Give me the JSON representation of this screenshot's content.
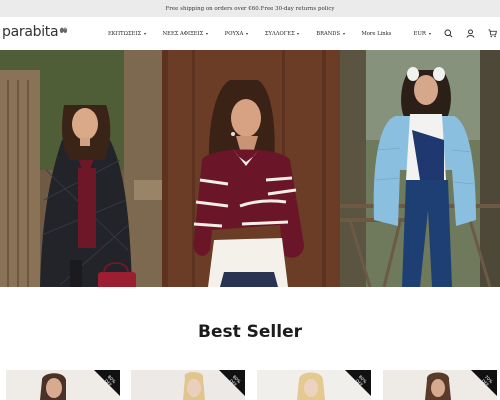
{
  "announcement": {
    "text": "Free shipping on orders over €60.Free 30-day returns policy"
  },
  "header": {
    "logo_text": "parabita",
    "nav": [
      {
        "label": "ΕΚΠΤΩΣΕΙΣ",
        "has_dropdown": true
      },
      {
        "label": "ΝΕΕΣ ΑΦΙΞΕΙΣ",
        "has_dropdown": true
      },
      {
        "label": "ΡΟΥΧΑ",
        "has_dropdown": true
      },
      {
        "label": "ΣΥΛΛΟΓΕΣ",
        "has_dropdown": true
      },
      {
        "label": "BRANDS",
        "has_dropdown": true
      },
      {
        "label": "More Links",
        "has_dropdown": false
      }
    ],
    "currency": "EUR",
    "icons": [
      "search-icon",
      "account-icon",
      "cart-icon"
    ]
  },
  "hero": {
    "panels": [
      {
        "name": "black quilted coat with burgundy sweater"
      },
      {
        "name": "burgundy striped sweater"
      },
      {
        "name": "light blue puffer jacket"
      }
    ]
  },
  "best_seller": {
    "title": "Best Seller",
    "products": [
      {
        "badge_value": "80%",
        "badge_label": "OFF"
      },
      {
        "badge_value": "80%",
        "badge_label": "OFF"
      },
      {
        "badge_value": "80%",
        "badge_label": "OFF"
      },
      {
        "badge_value": "70%",
        "badge_label": "OFF"
      }
    ]
  },
  "colors": {
    "announcement_bg": "#ebebeb",
    "text": "#222222",
    "badge": "#111111"
  }
}
